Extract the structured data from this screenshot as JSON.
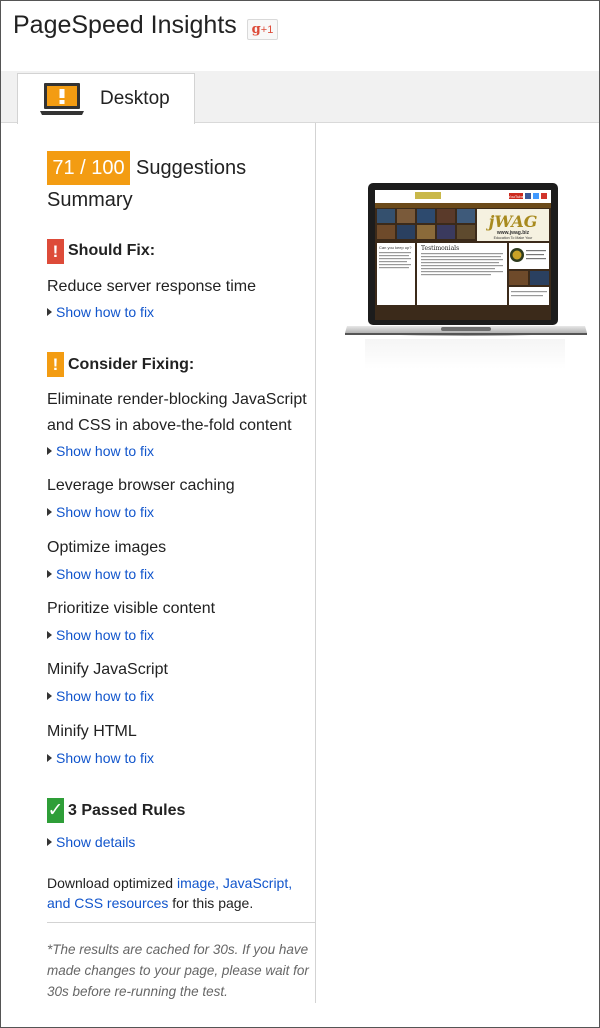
{
  "header": {
    "title": "PageSpeed Insights",
    "gplus_label": "g",
    "gplus_suffix": "+1"
  },
  "tabs": [
    {
      "label": "Desktop",
      "icon": "desktop-warning-icon",
      "active": true
    }
  ],
  "score": {
    "value": "71 / 100",
    "label": "Suggestions",
    "summary": "Summary"
  },
  "should_fix": {
    "heading": "Should Fix:",
    "badge": "!",
    "items": [
      {
        "title": "Reduce server response time",
        "link": "Show how to fix"
      }
    ]
  },
  "consider_fixing": {
    "heading": "Consider Fixing:",
    "badge": "!",
    "items": [
      {
        "title": "Eliminate render-blocking JavaScript and CSS in above-the-fold content",
        "link": "Show how to fix"
      },
      {
        "title": "Leverage browser caching",
        "link": "Show how to fix"
      },
      {
        "title": "Optimize images",
        "link": "Show how to fix"
      },
      {
        "title": "Prioritize visible content",
        "link": "Show how to fix"
      },
      {
        "title": "Minify JavaScript",
        "link": "Show how to fix"
      },
      {
        "title": "Minify HTML",
        "link": "Show how to fix"
      }
    ]
  },
  "passed": {
    "heading": "3 Passed Rules",
    "badge": "✓",
    "link": "Show details"
  },
  "download": {
    "prefix": "Download optimized ",
    "link": "image, JavaScript, and CSS resources",
    "suffix": " for this page."
  },
  "cache_note": "*The results are cached for 30s. If you have made changes to your page, please wait for 30s before re-running the test.",
  "preview": {
    "site_logo": "jWAG",
    "site_url": "www.jwag.biz",
    "tagline_1": "Education To Make Your",
    "tagline_2": "Jewelry Business Better",
    "section_title": "Testimonials",
    "left_heading": "Can you keep up?",
    "social": [
      "YouTube",
      "f",
      "t",
      "in"
    ]
  },
  "colors": {
    "score_bg": "#f39c12",
    "should_fix": "#dd4b39",
    "consider": "#f39c12",
    "passed": "#2e9e38",
    "link": "#1155cc"
  }
}
